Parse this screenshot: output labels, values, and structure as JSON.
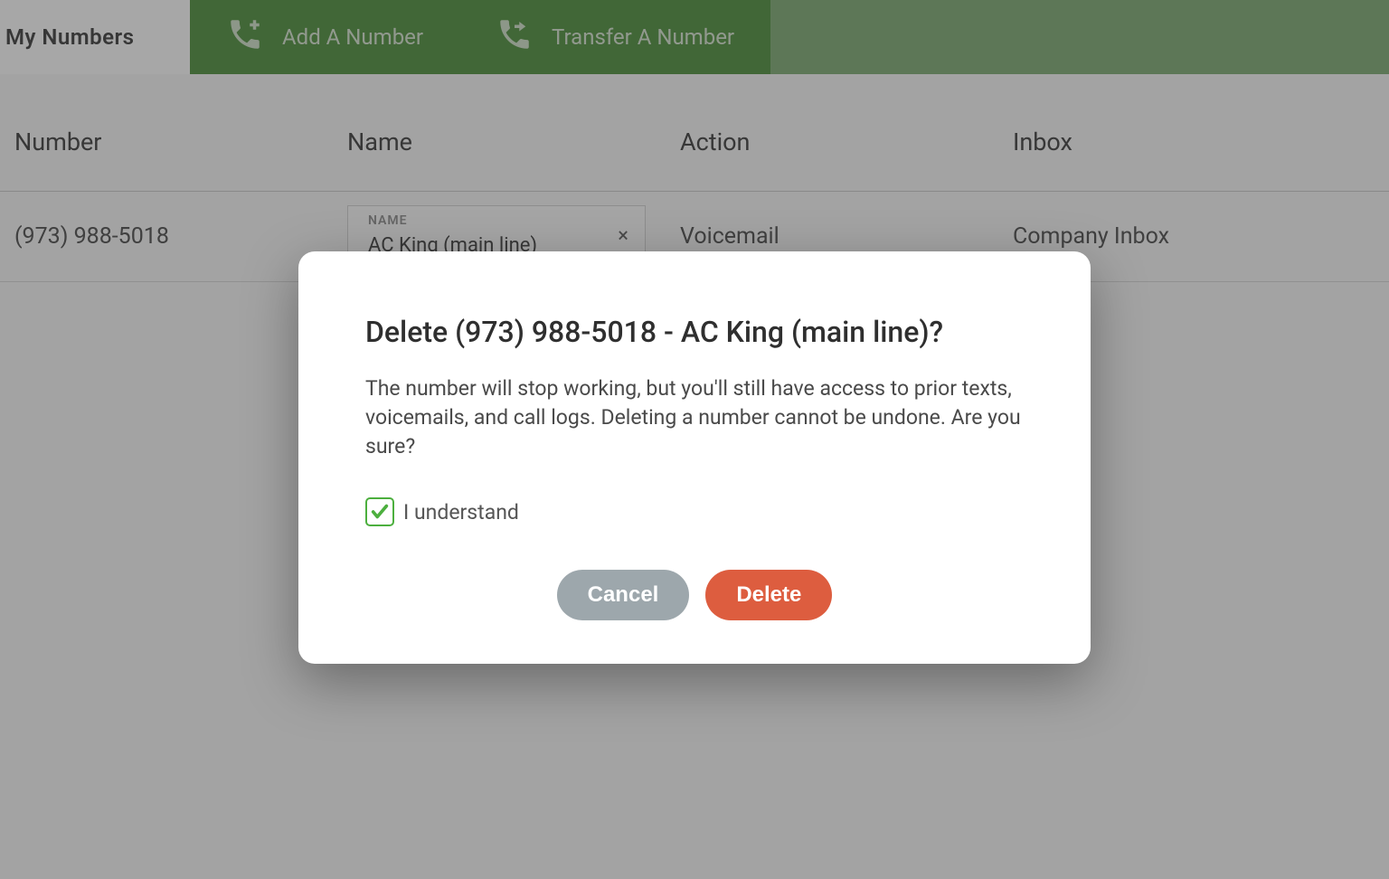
{
  "header": {
    "title": "My Numbers",
    "add_label": "Add A Number",
    "transfer_label": "Transfer A Number"
  },
  "table": {
    "headers": {
      "number": "Number",
      "name": "Name",
      "action": "Action",
      "inbox": "Inbox"
    },
    "row": {
      "number": "(973) 988-5018",
      "name_field_label": "NAME",
      "name_value": "AC King (main line)",
      "clear_glyph": "×",
      "action": "Voicemail",
      "inbox": "Company Inbox"
    }
  },
  "modal": {
    "title": "Delete (973) 988-5018 - AC King (main line)?",
    "body": "The number will stop working, but you'll still have access to prior texts, voicemails, and call logs. Deleting a number cannot be undone. Are you sure?",
    "checkbox_label": "I understand",
    "checkbox_checked": true,
    "cancel_label": "Cancel",
    "delete_label": "Delete"
  }
}
